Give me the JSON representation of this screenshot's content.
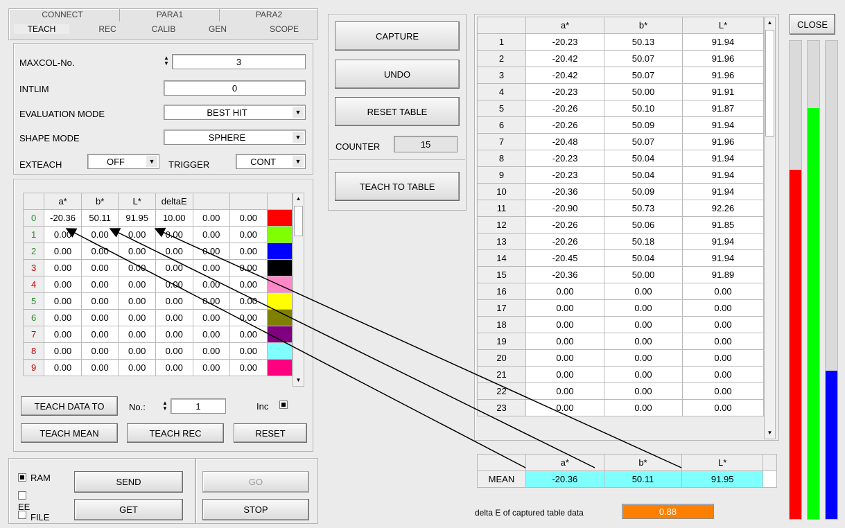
{
  "tabs_row1": [
    "CONNECT",
    "PARA1",
    "PARA2"
  ],
  "tabs_row2": [
    "TEACH",
    "REC",
    "CALIB",
    "GEN",
    "SCOPE"
  ],
  "settings": {
    "maxcol_label": "MAXCOL-No.",
    "maxcol_value": "3",
    "intlim_label": "INTLIM",
    "intlim_value": "0",
    "eval_label": "EVALUATION MODE",
    "eval_value": "BEST HIT",
    "shape_label": "SHAPE MODE",
    "shape_value": "SPHERE",
    "exteach_label": "EXTEACH",
    "exteach_value": "OFF",
    "trigger_label": "TRIGGER",
    "trigger_value": "CONT"
  },
  "teach_table": {
    "headers": [
      "",
      "a*",
      "b*",
      "L*",
      "deltaE",
      "",
      ""
    ],
    "rows": [
      {
        "n": "0",
        "a": "-20.36",
        "b": "50.11",
        "l": "91.95",
        "d": "10.00",
        "c5": "0.00",
        "c6": "0.00",
        "color": "#ff0000"
      },
      {
        "n": "1",
        "a": "0.00",
        "b": "0.00",
        "l": "0.00",
        "d": "0.00",
        "c5": "0.00",
        "c6": "0.00",
        "color": "#80ff00"
      },
      {
        "n": "2",
        "a": "0.00",
        "b": "0.00",
        "l": "0.00",
        "d": "0.00",
        "c5": "0.00",
        "c6": "0.00",
        "color": "#0000ff"
      },
      {
        "n": "3",
        "a": "0.00",
        "b": "0.00",
        "l": "0.00",
        "d": "0.00",
        "c5": "0.00",
        "c6": "0.00",
        "color": "#000000"
      },
      {
        "n": "4",
        "a": "0.00",
        "b": "0.00",
        "l": "0.00",
        "d": "0.00",
        "c5": "0.00",
        "c6": "0.00",
        "color": "#ff88c8"
      },
      {
        "n": "5",
        "a": "0.00",
        "b": "0.00",
        "l": "0.00",
        "d": "0.00",
        "c5": "0.00",
        "c6": "0.00",
        "color": "#ffff00"
      },
      {
        "n": "6",
        "a": "0.00",
        "b": "0.00",
        "l": "0.00",
        "d": "0.00",
        "c5": "0.00",
        "c6": "0.00",
        "color": "#808000"
      },
      {
        "n": "7",
        "a": "0.00",
        "b": "0.00",
        "l": "0.00",
        "d": "0.00",
        "c5": "0.00",
        "c6": "0.00",
        "color": "#800080"
      },
      {
        "n": "8",
        "a": "0.00",
        "b": "0.00",
        "l": "0.00",
        "d": "0.00",
        "c5": "0.00",
        "c6": "0.00",
        "color": "#80ffff"
      },
      {
        "n": "9",
        "a": "0.00",
        "b": "0.00",
        "l": "0.00",
        "d": "0.00",
        "c5": "0.00",
        "c6": "0.00",
        "color": "#ff0080"
      }
    ]
  },
  "teach_controls": {
    "teach_data_to": "TEACH DATA TO",
    "no_label": "No.:",
    "no_value": "1",
    "inc_label": "Inc",
    "teach_mean": "TEACH MEAN",
    "teach_rec": "TEACH REC",
    "reset": "RESET"
  },
  "bottom": {
    "ram": "RAM",
    "ee": "EE",
    "file": "FILE",
    "send": "SEND",
    "get": "GET",
    "go": "GO",
    "stop": "STOP"
  },
  "capture": {
    "capture": "CAPTURE",
    "undo": "UNDO",
    "reset_table": "RESET TABLE",
    "counter_label": "COUNTER",
    "counter_value": "15",
    "teach_to_table": "TEACH TO TABLE"
  },
  "capture_table": {
    "headers": [
      "",
      "a*",
      "b*",
      "L*"
    ],
    "rows": [
      [
        "1",
        "-20.23",
        "50.13",
        "91.94"
      ],
      [
        "2",
        "-20.42",
        "50.07",
        "91.96"
      ],
      [
        "3",
        "-20.42",
        "50.07",
        "91.96"
      ],
      [
        "4",
        "-20.23",
        "50.00",
        "91.91"
      ],
      [
        "5",
        "-20.26",
        "50.10",
        "91.87"
      ],
      [
        "6",
        "-20.26",
        "50.09",
        "91.94"
      ],
      [
        "7",
        "-20.48",
        "50.07",
        "91.96"
      ],
      [
        "8",
        "-20.23",
        "50.04",
        "91.94"
      ],
      [
        "9",
        "-20.23",
        "50.04",
        "91.94"
      ],
      [
        "10",
        "-20.36",
        "50.09",
        "91.94"
      ],
      [
        "11",
        "-20.90",
        "50.73",
        "92.26"
      ],
      [
        "12",
        "-20.26",
        "50.06",
        "91.85"
      ],
      [
        "13",
        "-20.26",
        "50.18",
        "91.94"
      ],
      [
        "14",
        "-20.45",
        "50.04",
        "91.94"
      ],
      [
        "15",
        "-20.36",
        "50.00",
        "91.89"
      ],
      [
        "16",
        "0.00",
        "0.00",
        "0.00"
      ],
      [
        "17",
        "0.00",
        "0.00",
        "0.00"
      ],
      [
        "18",
        "0.00",
        "0.00",
        "0.00"
      ],
      [
        "19",
        "0.00",
        "0.00",
        "0.00"
      ],
      [
        "20",
        "0.00",
        "0.00",
        "0.00"
      ],
      [
        "21",
        "0.00",
        "0.00",
        "0.00"
      ],
      [
        "22",
        "0.00",
        "0.00",
        "0.00"
      ],
      [
        "23",
        "0.00",
        "0.00",
        "0.00"
      ]
    ]
  },
  "mean_table": {
    "headers": [
      "",
      "a*",
      "b*",
      "L*"
    ],
    "label": "MEAN",
    "a": "-20.36",
    "b": "50.11",
    "l": "91.95"
  },
  "delta": {
    "label": "delta E of captured table data",
    "value": "0.88"
  },
  "close": "CLOSE",
  "bars": {
    "red": 0.73,
    "green": 0.86,
    "blue": 0.31
  },
  "colors": {
    "accent_cyan": "#80ffff",
    "delta_orange": "#ff8000"
  }
}
